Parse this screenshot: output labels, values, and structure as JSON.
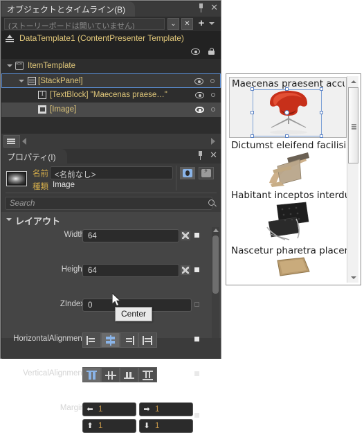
{
  "objects_panel": {
    "tab_label": "オブジェクトとタイムライン(B)",
    "pin_icon": "pin-icon",
    "close_icon": "close-icon",
    "storyboard": {
      "value": "(ストーリーボードは開いていません)",
      "chevrons_icon": "double-chevron-down-icon",
      "close_icon": "close-x-icon",
      "add_label": "+",
      "dropdown_icon": "chevron-down-icon"
    },
    "template_header": {
      "label": "DataTemplate1 (ContentPresenter Template)",
      "scope_up_icon": "scope-up-icon",
      "eye_icon": "eye-icon",
      "lock_icon": "lock-icon"
    },
    "tree": [
      {
        "label": "ItemTemplate",
        "icon": "template-icon",
        "indent": 20,
        "expander": true,
        "selected": false,
        "highlight": false,
        "eye": false,
        "dot": false
      },
      {
        "label": "[StackPanel]",
        "icon": "stackpanel-icon",
        "indent": 38,
        "expander": true,
        "selected": true,
        "highlight": false,
        "eye": true,
        "eye_bold": false,
        "dot": true
      },
      {
        "label": "[TextBlock] \"Maecenas praese…\"",
        "icon": "textblock-icon",
        "indent": 54,
        "expander": false,
        "selected": false,
        "highlight": false,
        "eye": true,
        "eye_bold": false,
        "dot": true
      },
      {
        "label": "[Image]",
        "icon": "image-icon",
        "indent": 54,
        "expander": false,
        "selected": false,
        "highlight": true,
        "eye": true,
        "eye_bold": true,
        "dot": true
      }
    ]
  },
  "separator_toolbar": {
    "stack_icon": "stack-layers-icon",
    "left_arrow_icon": "arrow-left-icon",
    "right_arrow_icon": "arrow-right-icon"
  },
  "properties_panel": {
    "tab_label": "プロパティ(I)",
    "pin_icon": "pin-icon",
    "close_icon": "close-icon",
    "thumbnail_icon": "element-thumbnail-icon",
    "name_label": "名前",
    "name_value": "<名前なし>",
    "kind_label": "種類",
    "kind_value": "Image",
    "toggle_pointer_icon": "hit-test-icon",
    "toggle_events_icon": "events-icon",
    "search_placeholder": "Search",
    "search_value": "",
    "search_icon": "search-icon",
    "section": {
      "title": "レイアウト",
      "expander_icon": "chevron-down-icon",
      "rows": [
        {
          "label": "Width",
          "value": "64",
          "has_advanced": true,
          "marker": "solid"
        },
        {
          "label": "Height",
          "value": "64",
          "has_advanced": true,
          "marker": "solid"
        },
        {
          "label": "ZIndex",
          "value": "0",
          "has_advanced": false,
          "marker": "hollow"
        }
      ],
      "horizontal_alignment": {
        "label": "HorizontalAlignment",
        "options": [
          "Left",
          "Center",
          "Right",
          "Stretch"
        ],
        "selected": "Center",
        "marker": "solid"
      },
      "vertical_alignment": {
        "label": "VerticalAlignment",
        "options": [
          "Top",
          "Center",
          "Bottom",
          "Stretch"
        ],
        "selected": "Top",
        "marker": "solid"
      },
      "margin": {
        "label": "Margin",
        "left": "1",
        "right": "1",
        "top": "1",
        "bottom": "1",
        "left_icon": "arrow-left-icon",
        "right_icon": "arrow-right-icon",
        "top_icon": "arrow-up-icon",
        "bottom_icon": "arrow-down-icon",
        "marker": "solid"
      }
    },
    "scrollbar": {
      "up_icon": "scroll-up-icon"
    }
  },
  "tooltip": {
    "text": "Center"
  },
  "cursor": {
    "icon": "mouse-pointer-icon"
  },
  "preview": {
    "items": [
      {
        "text": "Maecenas praesent accum",
        "image": "red-swan-chair",
        "selected": true
      },
      {
        "text": "Dictumst eleifend facilisi f",
        "image": "wooden-armchair",
        "selected": false
      },
      {
        "text": "Habitant inceptos interdu",
        "image": "black-barcelona-chair",
        "selected": false
      },
      {
        "text": "Nascetur pharetra placera",
        "image": "tan-flat-chair",
        "selected": false
      }
    ],
    "scrollbar": {
      "up_icon": "scroll-up-icon",
      "down_icon": "scroll-down-icon"
    }
  },
  "colors": {
    "panel_bg": "#3b3b3b",
    "dock_bg": "#2d2d2d",
    "accent_blue": "#8ab4e8",
    "selection_border": "#5b8fd6",
    "label_gold": "#cfa94a",
    "tree_text": "#e0c77a",
    "value_orange": "#c99a4a",
    "preview_bg": "#ffffff"
  }
}
